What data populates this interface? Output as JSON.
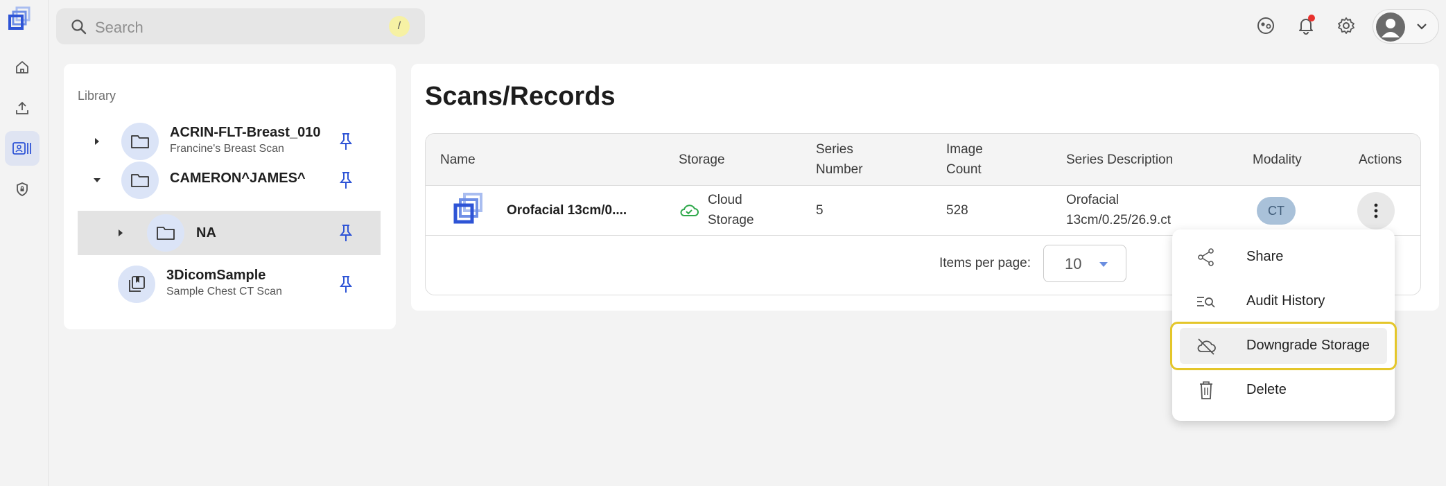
{
  "app": {
    "brand_color": "#2e54d6",
    "accent_light": "#dbe4f7"
  },
  "rail": {
    "items": [
      {
        "icon": "home-icon",
        "active": false
      },
      {
        "icon": "upload-icon",
        "active": false
      },
      {
        "icon": "records-icon",
        "active": true
      },
      {
        "icon": "shield-icon",
        "active": false
      }
    ]
  },
  "search": {
    "placeholder": "Search",
    "shortcut": "/"
  },
  "topbar": {
    "icons": [
      "support-icon",
      "bell-icon",
      "gear-icon",
      "avatar",
      "chevron-down-icon"
    ],
    "notification_dot": true
  },
  "library": {
    "title": "Library",
    "items": [
      {
        "name": "ACRIN-FLT-Breast_010",
        "subtitle": "Francine's Breast Scan",
        "expanded": false
      },
      {
        "name": "CAMERON^JAMES^",
        "subtitle": "",
        "expanded": true
      },
      {
        "name": "NA",
        "subtitle": "",
        "expanded": false,
        "selected": true
      },
      {
        "name": "3DicomSample",
        "subtitle": "Sample Chest CT Scan"
      }
    ]
  },
  "main": {
    "title": "Scans/Records",
    "columns": {
      "name": "Name",
      "storage": "Storage",
      "series_number_1": "Series",
      "series_number_2": "Number",
      "image_count_1": "Image",
      "image_count_2": "Count",
      "series_description": "Series Description",
      "modality": "Modality",
      "actions": "Actions"
    },
    "row": {
      "name": "Orofacial 13cm/0....",
      "storage_1": "Cloud",
      "storage_2": "Storage",
      "series_number": "5",
      "image_count": "528",
      "series_description_1": "Orofacial",
      "series_description_2": "13cm/0.25/26.9.ct",
      "modality": "CT"
    },
    "pagination": {
      "items_per_page_label": "Items per page:",
      "items_per_page_value": "10"
    }
  },
  "menu": {
    "items": [
      {
        "label": "Share",
        "icon": "share-icon"
      },
      {
        "label": "Audit History",
        "icon": "audit-history-icon"
      },
      {
        "label": "Downgrade Storage",
        "icon": "cloud-off-icon",
        "highlighted": true
      },
      {
        "label": "Delete",
        "icon": "trash-icon"
      }
    ]
  }
}
